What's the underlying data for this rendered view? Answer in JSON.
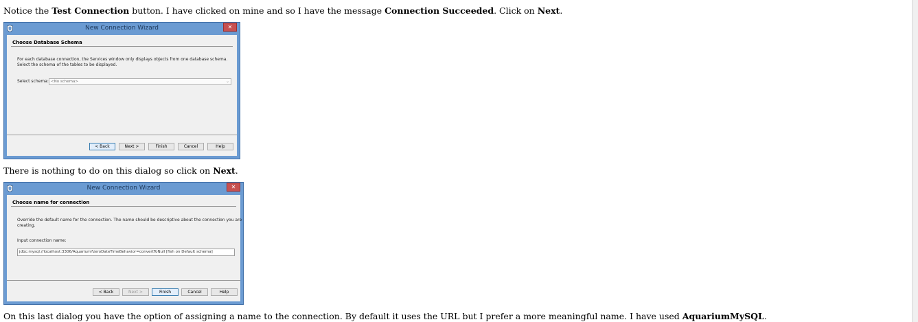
{
  "paragraphs": {
    "p1": {
      "t1": "Notice the ",
      "b1": "Test Connection",
      "t2": " button. I have clicked on mine and so I have the message ",
      "b2": "Connection Succeeded",
      "t3": ". Click on ",
      "b3": "Next",
      "t4": "."
    },
    "p2": {
      "t1": "There is nothing to do on this dialog so click on ",
      "b1": "Next",
      "t2": "."
    },
    "p3": {
      "t1": "On this last dialog you have the option of assigning a name to the connection. By default it uses the URL but I prefer a more meaningful name. I have used ",
      "b1": "AquariumMySQL",
      "t2": "."
    }
  },
  "dialog1": {
    "title": "New Connection Wizard",
    "close_glyph": "✕",
    "heading": "Choose Database Schema",
    "desc_line1": "For each database connection, the Services window only displays objects from one database schema.",
    "desc_line2": "Select the schema of the tables to be displayed.",
    "schema_label": "Select schema:",
    "schema_value": "<No schema>",
    "dropdown_glyph": "⌄",
    "buttons": {
      "back": "< Back",
      "next": "Next >",
      "finish": "Finish",
      "cancel": "Cancel",
      "help": "Help"
    }
  },
  "dialog2": {
    "title": "New Connection Wizard",
    "close_glyph": "✕",
    "heading": "Choose name for connection",
    "desc_line1": "Override the default name for the connection. The name should be descriptive about the connection you are",
    "desc_line2": "creating.",
    "name_label": "Input connection name:",
    "name_value": "jdbc:mysql://localhost:3306/Aquarium?zeroDateTimeBehavior=convertToNull [fish on Default schema]",
    "buttons": {
      "back": "< Back",
      "next": "Next >",
      "finish": "Finish",
      "cancel": "Cancel",
      "help": "Help"
    }
  },
  "colors": {
    "frame": "#6b9bd2",
    "close": "#c75050",
    "client": "#f0f0f0"
  },
  "icons": {
    "app": "netbeans-shield-icon",
    "close": "close-icon",
    "dropdown": "chevron-down-icon"
  }
}
